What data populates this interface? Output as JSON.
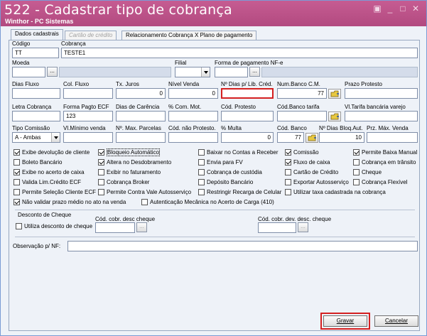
{
  "window": {
    "title": "522 - Cadastrar tipo de cobrança",
    "subtitle": "Winthor - PC Sistemas",
    "controls": [
      "▣",
      "_",
      "□",
      "✕"
    ]
  },
  "tabs": [
    {
      "label": "Dados cadastrais",
      "state": "active"
    },
    {
      "label": "Cartão de crédito",
      "state": "disabled"
    },
    {
      "label": "Relacionamento Cobrança X Plano de pagamento",
      "state": "normal"
    }
  ],
  "fields": {
    "codigo": {
      "label": "Código",
      "value": "TT"
    },
    "cobranca": {
      "label": "Cobrança",
      "value": "TESTE1"
    },
    "moeda": {
      "label": "Moeda",
      "value": ""
    },
    "filial": {
      "label": "Filial",
      "value": ""
    },
    "forma_pgto_nfe": {
      "label": "Forma de pagamento NF-e",
      "value": ""
    },
    "dias_fluxo": {
      "label": "Dias Fluxo",
      "value": ""
    },
    "col_fluxo": {
      "label": "Col. Fluxo",
      "value": ""
    },
    "tx_juros": {
      "label": "Tx. Juros",
      "value": "0"
    },
    "nivel_venda": {
      "label": "Nível Venda",
      "value": "0"
    },
    "n_dias_lib_cred": {
      "label": "Nº Dias p/ Lib. Créd.",
      "value": ""
    },
    "num_banco_cm": {
      "label": "Num.Banco C.M.",
      "value": "77"
    },
    "prazo_protesto": {
      "label": "Prazo Protesto",
      "value": ""
    },
    "letra_cobranca": {
      "label": "Letra Cobrança",
      "value": ""
    },
    "forma_pagto_ecf": {
      "label": "Forma Pagto ECF",
      "value": "123"
    },
    "dias_carencia": {
      "label": "Dias de Carência",
      "value": ""
    },
    "com_mot": {
      "label": "% Com. Mot.",
      "value": ""
    },
    "cod_protesto": {
      "label": "Cód. Protesto",
      "value": ""
    },
    "cod_banco_tarifa": {
      "label": "Cód.Banco tarifa",
      "value": ""
    },
    "vl_tarifa_bancaria": {
      "label": "Vl.Tarifa bancária varejo",
      "value": ""
    },
    "tipo_comissao": {
      "label": "Tipo Comissão",
      "value": "A - Ambas"
    },
    "vl_minimo_venda": {
      "label": "Vl.Mínimo venda",
      "value": ""
    },
    "n_max_parcelas": {
      "label": "Nº. Max. Parcelas",
      "value": ""
    },
    "cod_nao_protesto": {
      "label": "Cód. não Protesto.",
      "value": ""
    },
    "multa": {
      "label": "% Multa",
      "value": "0"
    },
    "cod_banco": {
      "label": "Cód. Banco",
      "value": "77"
    },
    "n_dias_bloq_aut": {
      "label": "Nº Dias Bloq.Aut.",
      "value": "10"
    },
    "prz_max_venda": {
      "label": "Prz. Máx. Venda",
      "value": ""
    }
  },
  "buttons": {
    "dots": "..."
  },
  "checkboxes": [
    {
      "label": "Exibe devolução de cliente",
      "checked": true
    },
    {
      "label": "Bloqueio Automático",
      "checked": true
    },
    {
      "label": "Baixar no Contas a Receber",
      "checked": false
    },
    {
      "label": "Comissão",
      "checked": true
    },
    {
      "label": "Permite Baixa Manual",
      "checked": true
    },
    {
      "label": "Boleto Bancário",
      "checked": false
    },
    {
      "label": "Altera no Desdobramento",
      "checked": true
    },
    {
      "label": "Envia para FV",
      "checked": false
    },
    {
      "label": "Fluxo de caixa",
      "checked": true
    },
    {
      "label": "Cobrança em trânsito",
      "checked": false
    },
    {
      "label": "Exibe no acerto de caixa",
      "checked": true
    },
    {
      "label": "Exibir no faturamento",
      "checked": false
    },
    {
      "label": "Cobrança de custódia",
      "checked": false
    },
    {
      "label": "Cartão de Crédito",
      "checked": false
    },
    {
      "label": "Cheque",
      "checked": false
    },
    {
      "label": "Valida Lim.Crédito ECF",
      "checked": false
    },
    {
      "label": "Cobrança Broker",
      "checked": false
    },
    {
      "label": "Depósito Bancário",
      "checked": false
    },
    {
      "label": "Exportar Autosserviço",
      "checked": false
    },
    {
      "label": "Cobrança Flexível",
      "checked": false
    },
    {
      "label": "Permite Seleção Cliente ECF",
      "checked": false
    },
    {
      "label": "Permite Contra Vale Autosserviço",
      "checked": false
    },
    {
      "label": "Restringir Recarga de Celular",
      "checked": false
    },
    {
      "label": "Utilizar taxa cadastrada na cobrança",
      "checked": false
    },
    {
      "label": "Não validar prazo médio no ato na venda",
      "checked": true
    },
    {
      "label": "Autenticação Mecânica no Acerto de Carga (410)",
      "checked": false
    }
  ],
  "desconto_cheque": {
    "title": "Desconto de Cheque",
    "checkbox": {
      "label": "Utiliza desconto de cheque",
      "checked": false
    },
    "cod_cobr_desc": {
      "label": "Cód. cobr. desc cheque",
      "value": ""
    },
    "cod_cobr_dev": {
      "label": "Cód. cobr. dev. desc. cheque",
      "value": ""
    }
  },
  "observacao": {
    "label": "Observação p/ NF:",
    "value": ""
  },
  "actions": {
    "gravar": "Gravar",
    "cancelar": "Cancelar"
  }
}
